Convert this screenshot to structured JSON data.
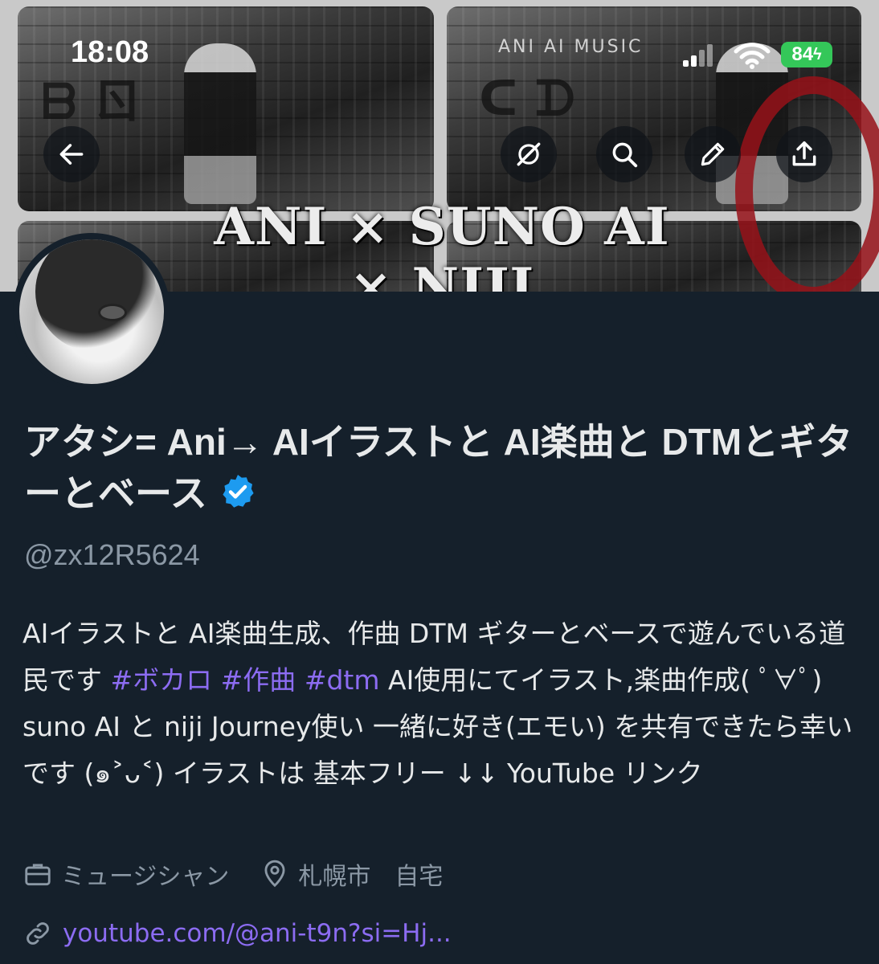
{
  "status_bar": {
    "time": "18:08",
    "battery": "84"
  },
  "banner": {
    "watermark": "ANI  AI MUSIC",
    "logo_text": "ANI × SUNO AI × NIJI"
  },
  "toolbar": {
    "back_icon": "arrow-left-icon",
    "grok_icon": "grok-icon",
    "search_icon": "search-icon",
    "edit_icon": "pencil-icon",
    "share_icon": "share-icon"
  },
  "profile": {
    "display_name": "アタシ= Ani→ AIイラストと AI楽曲と DTMとギターとベース",
    "handle": "@zx12R5624",
    "verified_color": "#1d9bf0",
    "bio_parts": {
      "p1": "AIイラストと AI楽曲生成、作曲 DTM ギターとベースで遊んでいる道民です ",
      "tag1": "#ボカロ",
      "tag2": "#作曲",
      "tag3": "#dtm",
      "p2": " AI使用にてイラスト,楽曲作成( ﾟ∀ﾟ) suno AI と niji Journey使い 一緒に好き(エモい) を共有できたら幸いです (๑˃ᴗ˂) イラストは 基本フリー ↓↓ YouTube リンク"
    },
    "category": "ミュージシャン",
    "location": "札幌市　自宅",
    "link": "youtube.com/@ani-t9n?si=Hj..."
  },
  "colors": {
    "background": "#15202b",
    "link": "#8c6cf2",
    "muted": "#8b98a5"
  }
}
